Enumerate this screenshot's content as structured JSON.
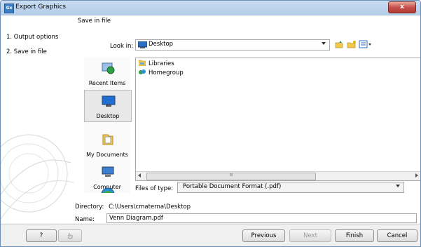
{
  "window": {
    "title": "Export Graphics",
    "app_icon": "Gx",
    "close_glyph": "x"
  },
  "steps": [
    {
      "label": "1.  Output options"
    },
    {
      "label": "2.  Save in file"
    }
  ],
  "save": {
    "group_label": "Save in file",
    "look_in_label": "Look in:",
    "look_in_value": "Desktop",
    "places": [
      {
        "label": "Recent Items",
        "icon": "recent-items-icon"
      },
      {
        "label": "Desktop",
        "icon": "desktop-icon"
      },
      {
        "label": "My Documents",
        "icon": "documents-icon"
      },
      {
        "label": "Computer",
        "icon": "computer-icon"
      }
    ],
    "files": [
      {
        "name": "Libraries",
        "icon": "libraries-icon"
      },
      {
        "name": "Homegroup",
        "icon": "homegroup-icon"
      }
    ],
    "scroll_grip": "III",
    "files_of_type_label": "Files of type:",
    "files_of_type_value": "Portable Document Format (.pdf)",
    "directory_label": "Directory:",
    "directory_value": "C:\\Users\\cmaterna\\Desktop",
    "name_label": "Name:",
    "name_value": "Venn Diagram.pdf"
  },
  "buttons": {
    "help": "?",
    "previous": "Previous",
    "next": "Next",
    "finish": "Finish",
    "cancel": "Cancel"
  },
  "colors": {
    "title_bar": "#b5cde8",
    "close_button": "#c75050",
    "folder": "#f2c94c"
  }
}
